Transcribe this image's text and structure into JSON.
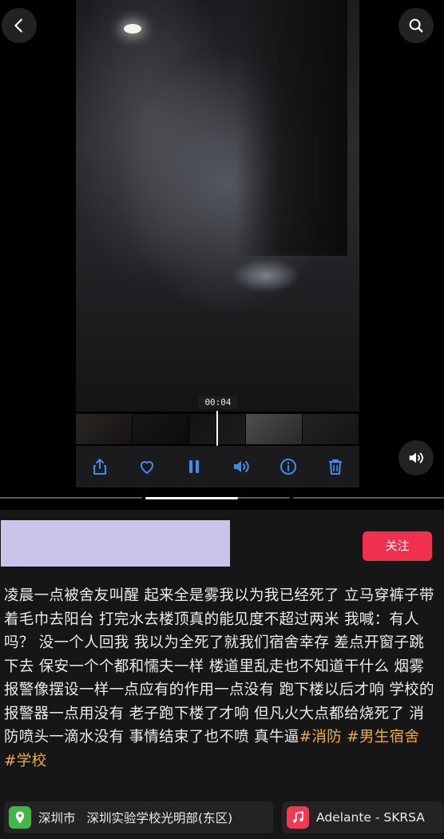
{
  "video": {
    "timestamp": "00:04",
    "progress_fraction": 0.64
  },
  "top_bar": {
    "back_icon": "chevron-left-icon",
    "search_icon": "search-icon"
  },
  "controls": {
    "share_icon": "share-icon",
    "like_icon": "heart-icon",
    "pause_icon": "pause-icon",
    "volume_icon": "speaker-icon",
    "info_icon": "info-icon",
    "delete_icon": "trash-icon",
    "accent_color": "#3f8cf0"
  },
  "post": {
    "follow_label": "关注",
    "caption_text": "凌晨一点被舍友叫醒 起来全是雾我以为我已经死了 立马穿裤子带着毛巾去阳台 打完水去楼顶真的能见度不超过两米 我喊：有人吗？     没一个人回我 我以为全死了就我们宿舍幸存 差点开窗子跳下去 保安一个个都和懦夫一样 楼道里乱走也不知道干什么 烟雾报警像摆设一样一点应有的作用一点没有 跑下楼以后才响 学校的报警器一点用没有 老子跑下楼了才响 但凡火大点都给烧死了 消防喷头一滴水没有 事情结束了也不喷 真牛逼",
    "hashtags": [
      "#消防",
      "#男生宿舍",
      "#学校"
    ],
    "hashtag_color": "#f2a93b",
    "follow_color": "#f0304f"
  },
  "location": {
    "city": "深圳市",
    "place": "深圳实验学校光明部(东区)"
  },
  "music": {
    "title": "Adelante - SKRSA"
  }
}
